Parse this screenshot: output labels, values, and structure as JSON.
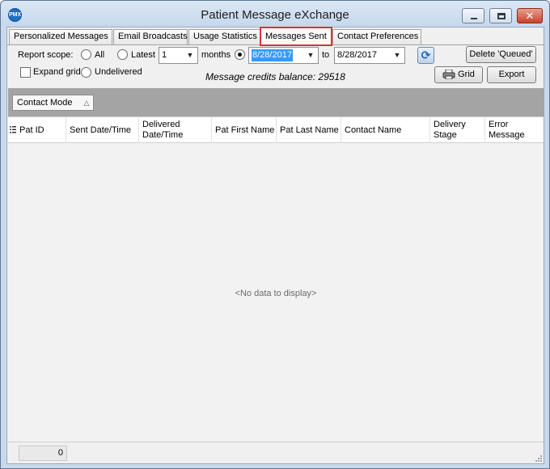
{
  "window": {
    "title": "Patient Message eXchange",
    "close_glyph": "✕",
    "icon_text": "PMX"
  },
  "tabs": [
    {
      "label": "Personalized Messages"
    },
    {
      "label": "Email Broadcasts"
    },
    {
      "label": "Usage Statistics"
    },
    {
      "label": "Messages Sent"
    },
    {
      "label": "Contact Preferences"
    }
  ],
  "controls": {
    "report_scope_label": "Report scope:",
    "all_label": "All",
    "latest_label": "Latest",
    "latest_value": "1",
    "months_label": "months",
    "from_date": "8/28/2017",
    "to_label": "to",
    "to_date": "8/28/2017",
    "expand_grid_label": "Expand grid",
    "undelivered_label": "Undelivered",
    "delete_queued_label": "Delete 'Queued'",
    "grid_label": "Grid",
    "export_label": "Export",
    "credits_text": "Message credits balance: 29518"
  },
  "groupbar": {
    "chip_label": "Contact Mode",
    "sort_glyph": "△"
  },
  "grid": {
    "columns": [
      {
        "label": "Pat ID"
      },
      {
        "label": "Sent Date/Time"
      },
      {
        "label": "Delivered Date/Time"
      },
      {
        "label": "Pat First Name"
      },
      {
        "label": "Pat Last Name"
      },
      {
        "label": "Contact Name"
      },
      {
        "label": "Delivery Stage"
      },
      {
        "label": "Error Message"
      }
    ],
    "empty_text": "<No data to display>"
  },
  "footer": {
    "count": "0"
  }
}
